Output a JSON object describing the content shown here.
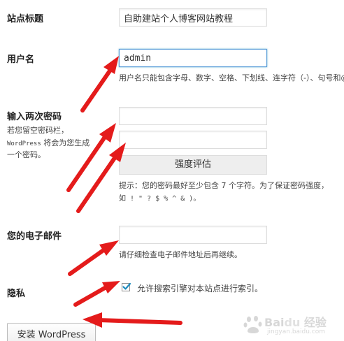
{
  "form": {
    "site_title": {
      "label": "站点标题",
      "value": "自助建站个人博客网站教程"
    },
    "username": {
      "label": "用户名",
      "value": "admin",
      "description": "用户名只能包含字母、数字、空格、下划线、连字符（-）、句号和@符号。"
    },
    "password": {
      "label": "输入两次密码",
      "help_line1": "若您留空密码栏，",
      "help_line2_prefix": "WordPress",
      "help_line2_suffix": " 将会为您生成",
      "help_line3": "一个密码。",
      "value1": "",
      "value2": "",
      "strength_label": "强度评估",
      "hint_line1": "提示：您的密码最好至少包含 7 个字符。为了保证密码强度，",
      "hint_line2": "如 ! \" ? $ % ^ & )。"
    },
    "email": {
      "label": "您的电子邮件",
      "value": "",
      "description": "请仔细检查电子邮件地址后再继续。"
    },
    "privacy": {
      "label": "隐私",
      "checkbox_label": "允许搜索引擎对本站点进行索引。",
      "checked": true
    },
    "install_button_label": "安装 WordPress"
  },
  "annotations": {
    "arrow_color": "#e41b1b",
    "count": 6
  },
  "colors": {
    "focus_border": "#5b9dd9",
    "checkmark": "#1e8cbe"
  }
}
